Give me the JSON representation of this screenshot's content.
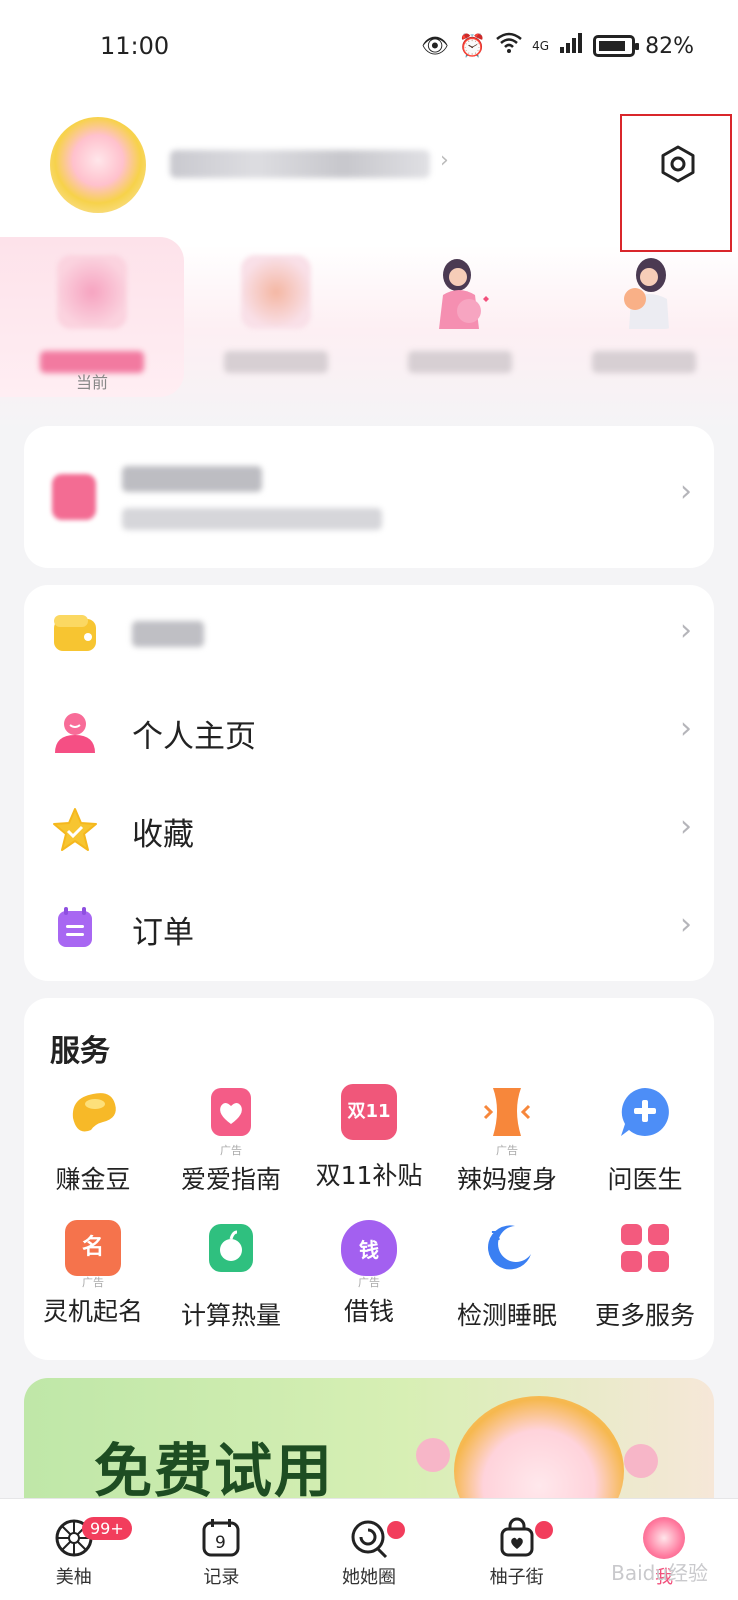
{
  "status_bar": {
    "time": "11:00",
    "network": "4G",
    "battery": "82%"
  },
  "profile": {
    "settings_label": "设置"
  },
  "stages": {
    "current_label": "当前"
  },
  "menu": {
    "items": [
      {
        "key": "wallet",
        "label": ""
      },
      {
        "key": "homepage",
        "label": "个人主页"
      },
      {
        "key": "favorites",
        "label": "收藏"
      },
      {
        "key": "orders",
        "label": "订单"
      }
    ]
  },
  "services": {
    "title": "服务",
    "items": [
      {
        "label": "赚金豆",
        "ad": "",
        "icon": "gold-bean-icon",
        "color": "#f6b928"
      },
      {
        "label": "爱爱指南",
        "ad": "广告",
        "icon": "heart-book-icon",
        "color": "#f45c87"
      },
      {
        "label": "双11补贴",
        "ad": "",
        "icon": "double11-icon",
        "color": "#f0577a"
      },
      {
        "label": "辣妈瘦身",
        "ad": "广告",
        "icon": "waist-icon",
        "color": "#f7873b"
      },
      {
        "label": "问医生",
        "ad": "",
        "icon": "doctor-chat-icon",
        "color": "#4d8ef7"
      },
      {
        "label": "灵机起名",
        "ad": "广告",
        "icon": "naming-icon",
        "color": "#f5734c"
      },
      {
        "label": "计算热量",
        "ad": "",
        "icon": "calorie-icon",
        "color": "#2fc07f"
      },
      {
        "label": "借钱",
        "ad": "广告",
        "icon": "money-bag-icon",
        "color": "#a360f0"
      },
      {
        "label": "检测睡眠",
        "ad": "",
        "icon": "sleep-moon-icon",
        "color": "#3a7ff2"
      },
      {
        "label": "更多服务",
        "ad": "",
        "icon": "more-grid-icon",
        "color": "#f35a7e"
      }
    ],
    "double11_text": "双11",
    "naming_text": "名",
    "money_text": "钱"
  },
  "banner": {
    "text": "免费试用"
  },
  "tabbar": {
    "items": [
      {
        "label": "美柚",
        "badge": "99+"
      },
      {
        "label": "记录",
        "icon_text": "9"
      },
      {
        "label": "她她圈"
      },
      {
        "label": "柚子街"
      },
      {
        "label": "我"
      }
    ]
  },
  "watermark": "Baidu经验"
}
